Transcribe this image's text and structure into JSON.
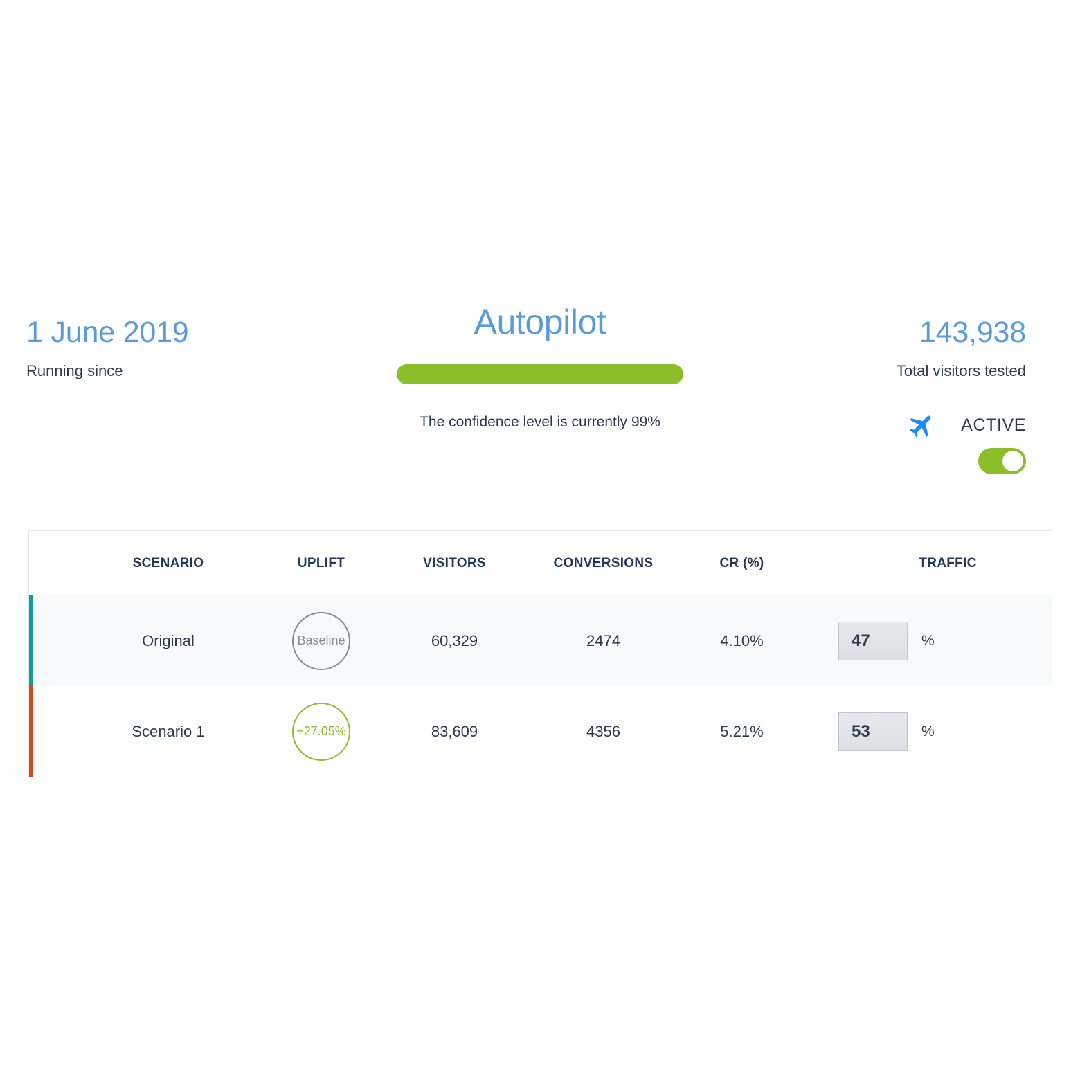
{
  "header": {
    "left": {
      "date": "1 June 2019",
      "caption": "Running since"
    },
    "center": {
      "title": "Autopilot",
      "confidence_caption": "The confidence level is currently 99%",
      "confidence_percent": 99,
      "bar_color": "#8cbe2a"
    },
    "right": {
      "total_visitors": "143,938",
      "total_visitors_caption": "Total visitors tested",
      "plane_icon": "airplane-icon",
      "plane_icon_color": "#1a8cff",
      "status_label": "ACTIVE",
      "toggle_on": true,
      "toggle_color": "#8cbe2a"
    }
  },
  "table": {
    "columns": [
      "SCENARIO",
      "UPLIFT",
      "VISITORS",
      "CONVERSIONS",
      "CR (%)",
      "TRAFFIC"
    ],
    "rows": [
      {
        "accent_color": "#0e9e9a",
        "scenario": "Original",
        "uplift": "Baseline",
        "uplift_positive": false,
        "visitors": "60,329",
        "conversions": "2474",
        "cr": "4.10%",
        "traffic": "47",
        "traffic_unit": "%"
      },
      {
        "accent_color": "#d9451b",
        "scenario": "Scenario 1",
        "uplift": "+27.05%",
        "uplift_positive": true,
        "visitors": "83,609",
        "conversions": "4356",
        "cr": "5.21%",
        "traffic": "53",
        "traffic_unit": "%"
      }
    ]
  }
}
